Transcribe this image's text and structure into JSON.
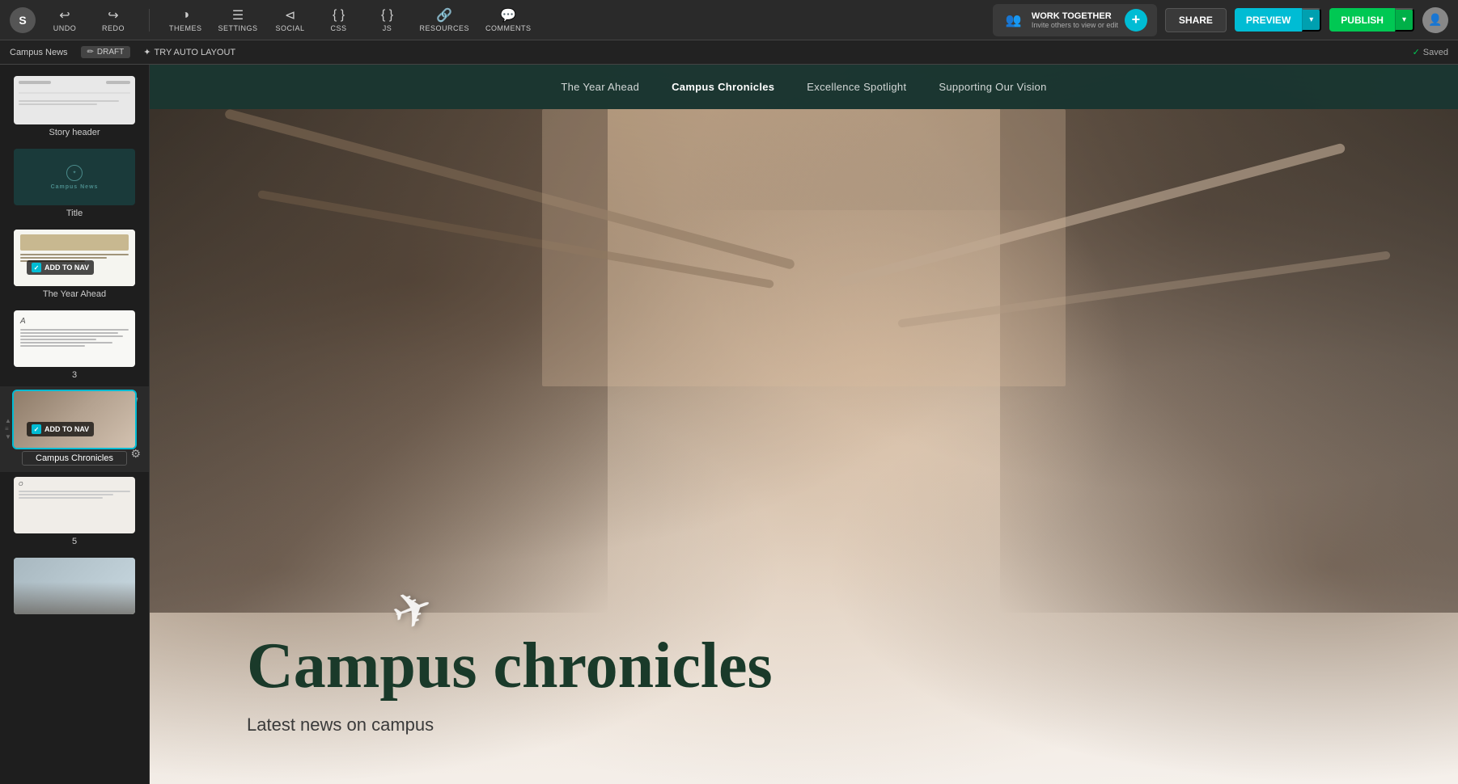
{
  "logo": "S",
  "toolbar": {
    "undo": "UNDO",
    "redo": "REDO",
    "themes": "THEMES",
    "settings": "SETTINGS",
    "social": "SOCIAL",
    "css": "CSS",
    "js": "JS",
    "resources": "RESOURCES",
    "comments": "COMMENTS"
  },
  "work_together": {
    "title": "WORK TOGETHER",
    "subtitle": "Invite others to view or edit"
  },
  "header_buttons": {
    "share": "SHARE",
    "preview": "PREVIEW",
    "publish": "PUBLISH"
  },
  "second_bar": {
    "page_name": "Campus News",
    "draft_label": "DRAFT",
    "edit_icon": "✏",
    "auto_layout": "TRY AUTO LAYOUT",
    "saved": "Saved"
  },
  "sidebar": {
    "items": [
      {
        "id": 1,
        "label": "Story header",
        "type": "story-header",
        "has_nav": false,
        "is_active": false,
        "has_input": false
      },
      {
        "id": 2,
        "label": "Title",
        "type": "title",
        "has_nav": false,
        "is_active": false,
        "has_input": false
      },
      {
        "id": 3,
        "label": "The Year Ahead",
        "type": "year-ahead",
        "has_nav": true,
        "nav_label": "ADD TO NAV",
        "is_active": false,
        "has_input": false
      },
      {
        "id": 4,
        "label": "3",
        "type": "text-page",
        "has_nav": false,
        "is_active": false,
        "has_input": false
      },
      {
        "id": 5,
        "label": "Campus Chronicles",
        "type": "campus-chronicles",
        "has_nav": true,
        "nav_label": "ADD TO NAV",
        "is_active": true,
        "has_input": true,
        "input_value": "Campus Chronicles"
      },
      {
        "id": 6,
        "label": "5",
        "type": "page5",
        "has_nav": false,
        "is_active": false,
        "has_input": false
      },
      {
        "id": 7,
        "label": "",
        "type": "page6",
        "has_nav": false,
        "is_active": false,
        "has_input": false
      }
    ]
  },
  "preview": {
    "nav_items": [
      {
        "label": "The Year Ahead",
        "active": false
      },
      {
        "label": "Campus Chronicles",
        "active": true
      },
      {
        "label": "Excellence Spotlight",
        "active": false
      },
      {
        "label": "Supporting Our Vision",
        "active": false
      }
    ],
    "hero_title": "Campus chronicles",
    "hero_subtitle": "Latest news on campus"
  },
  "colors": {
    "accent_cyan": "#00bcd4",
    "accent_green": "#00c853",
    "nav_dark": "#1a3a35",
    "hero_title_color": "#1a3a2a"
  }
}
